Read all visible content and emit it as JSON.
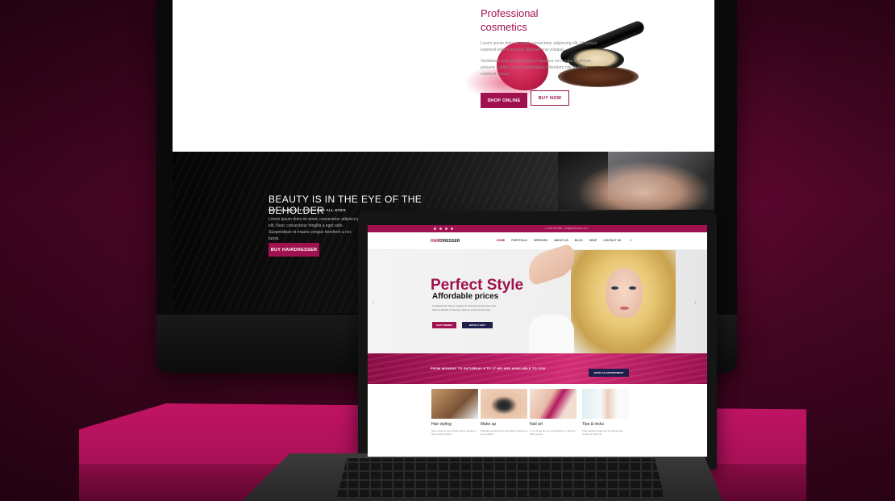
{
  "colors": {
    "brand": "#a0124f",
    "background": "#4a0625",
    "pedestal": "#c21464",
    "navy_button": "#1e1f4d"
  },
  "desktop_site": {
    "cosmetics_section": {
      "title_line1": "Professional",
      "title_line2": "cosmetics",
      "paragraph1": "Lorem ipsum dolor sit amet, consectetur adipiscing elit. Ut cursus euismod odio et suscipit. Aliquam erat volutpat.",
      "paragraph2": "Vestibulum ante ipsum primis in faucibus orci luctus et ultrices posuere cubilia Curae; Suspendisse bibendum nisi pharetra euismod cursus.",
      "shop_button": "SHOP ONLINE",
      "buy_button": "BUY NOW"
    },
    "beauty_section": {
      "title": "BEAUTY IS IN THE EYE OF THE BEHOLDER",
      "subtitle": "WITH US, BEAUTY REACHES ALL EYES",
      "paragraph": "Lorem ipsum dolor sit amet, consectetur adipiscing elit. Nunc consectetur fringilla a eget odio. Suspendisse et mauris congue hendrerit a nec turpis.",
      "button": "BUY HAIRDRESSER"
    }
  },
  "laptop_site": {
    "topbar": {
      "social_icons": [
        "facebook-icon",
        "twitter-icon",
        "instagram-icon",
        "youtube-icon"
      ],
      "info": "+1 234 567 890 · info@hairdresser.com"
    },
    "logo_accent": "HAIR",
    "logo_rest": "DRESSER",
    "nav": [
      "HOME",
      "PORTFOLIO",
      "SERVICES",
      "ABOUT US",
      "BLOG",
      "SHOP",
      "CONTACT US"
    ],
    "hero": {
      "title": "Perfect Style",
      "subtitle": "Affordable prices",
      "text": "A Hairdresser Theme created for business owners that care about a lifestyle of beauty, make up and personal style.",
      "button_primary": "OUR THEMES",
      "button_secondary": "BOOK A VISIT"
    },
    "band": {
      "text": "FROM MONDAY TO SATURDAY 8 TO 17 WE ARE AVAILABLE TO YOU",
      "button": "BOOK AN APPOINTMENT"
    },
    "services": [
      {
        "title": "Hair styling",
        "text": "Nunc a ante et nisi semper cursus. Aenean in felis ut dolor porttitor."
      },
      {
        "title": "Make up",
        "text": "Phasellus at elementum nisl. Etiam in lectus eu ante gravida."
      },
      {
        "title": "Nail art",
        "text": "In eu ornare leo, sit amet facilisis ex. Sed sed libero tempor."
      },
      {
        "title": "Tips & tricks",
        "text": "Cras sodales feugiat est, sed lacinia sem pretium at. Duis vel."
      }
    ]
  }
}
